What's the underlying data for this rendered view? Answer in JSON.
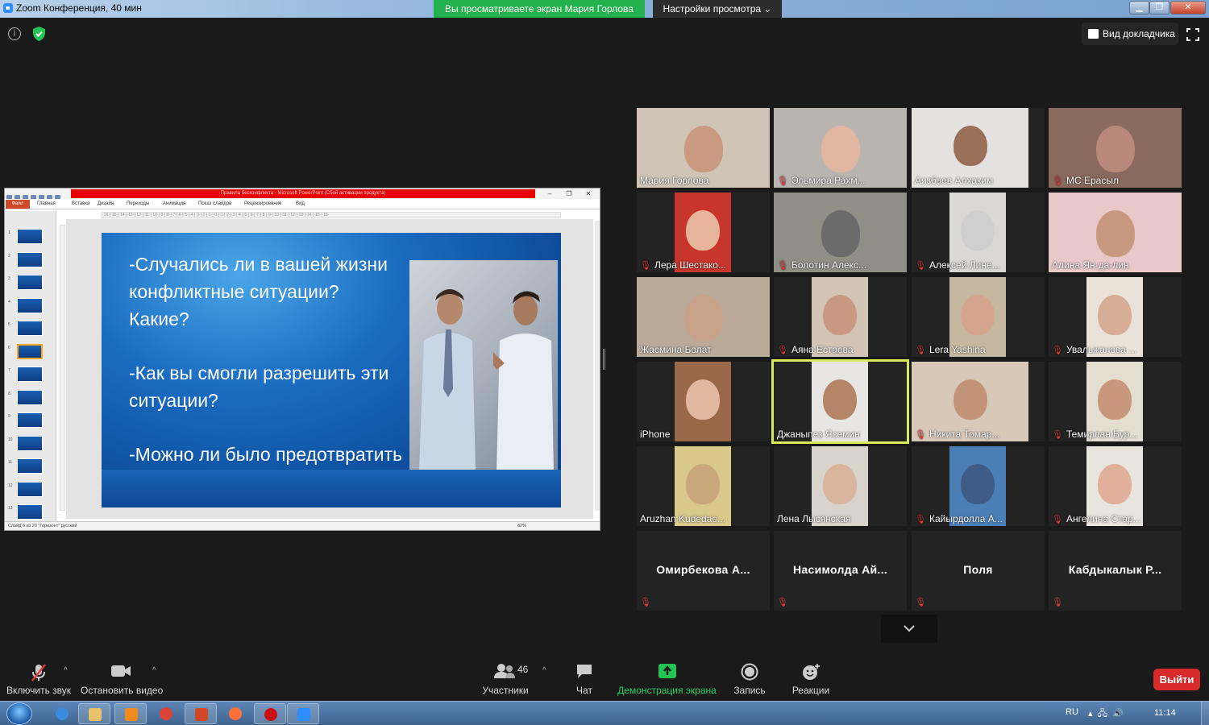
{
  "window": {
    "title": "Zoom Конференция, 40 мин",
    "share_banner": "Вы просматриваете экран Мария Горлова",
    "view_options": "Настройки просмотра ⌄",
    "min": "▁",
    "max": "❐",
    "close": "✕"
  },
  "top": {
    "speaker_view_label": "Вид докладчика"
  },
  "ppt": {
    "window_title": "Правила бесконфликта - Microsoft PowerPoint (Сбой активации продукта)",
    "window_controls": [
      "–",
      "❐",
      "✕"
    ],
    "tabs": [
      "Файл",
      "Главная",
      "Вставка",
      "Дизайн",
      "Переходы",
      "Анимация",
      "Показ слайдов",
      "Рецензирование",
      "Вид"
    ],
    "ruler_text": "·16·|·15·|·14·|·13·|·12·|·11·|·10·|·9·|·8·|·7·|·6·|·5·|·4·|·3·|·2·|·1·|·0·|·1·|·2·|·3·|·4·|·5·|·6·|·7·|·8·|·9·|·10·|·11·|·12·|·13·|·14·|·15·|·16·",
    "thumbnail_numbers": [
      "1",
      "2",
      "3",
      "4",
      "5",
      "6",
      "7",
      "8",
      "9",
      "10",
      "11",
      "12",
      "13"
    ],
    "selected_thumbnail": "6",
    "slide_paragraphs": [
      "-Случались ли в вашей жизни конфликтные ситуации? Какие?",
      "-Как вы смогли разрешить эти ситуации?",
      "-Можно ли было предотвратить такие ситуации?"
    ],
    "status_left": "Слайд 6 из 20   \"Горизонт\"   русский",
    "zoom": "82%"
  },
  "participants_grid": [
    {
      "name": "Мария Горлова",
      "muted": false,
      "video": true,
      "skin": "#c99a80",
      "bg": "#cfc4b6"
    },
    {
      "name": "Эльмира Рахм...",
      "muted": true,
      "video": true,
      "skin": "#e0b6a0",
      "bg": "#b8b4b0"
    },
    {
      "name": "Аязбаев Алхаким",
      "muted": false,
      "video": true,
      "skin": "#9a7058",
      "bg": "#e3e2e0"
    },
    {
      "name": "МС Ерасыл",
      "muted": true,
      "video": true,
      "skin": "#b8897a",
      "bg": "#8a6a5e"
    },
    {
      "name": "Лера Шестако...",
      "muted": true,
      "video": true,
      "skin": "#e6b49b",
      "bg": "#c7352b"
    },
    {
      "name": "Болотин Алекс...",
      "muted": true,
      "video": true,
      "skin": "#6b6b6b",
      "bg": "#8f8f86"
    },
    {
      "name": "Алексей Лине...",
      "muted": true,
      "video": true,
      "skin": "#cfcfcf",
      "bg": "#d9d8d5"
    },
    {
      "name": "Алина Ян-да-лин",
      "muted": false,
      "video": true,
      "skin": "#c79a80",
      "bg": "#e8c8c8"
    },
    {
      "name": "Жасмина Болат",
      "muted": false,
      "video": true,
      "skin": "#c8a38a",
      "bg": "#b9aa9a"
    },
    {
      "name": "Аяна Естаева",
      "muted": true,
      "video": true,
      "skin": "#c99880",
      "bg": "#d3c5b6"
    },
    {
      "name": "Lera Yashina",
      "muted": true,
      "video": true,
      "skin": "#d4a58a",
      "bg": "#c5b7a0"
    },
    {
      "name": "Увальжанова ...",
      "muted": true,
      "video": true,
      "skin": "#d7ad96",
      "bg": "#eae2d8"
    },
    {
      "name": "iPhone",
      "muted": false,
      "video": true,
      "skin": "#e1b7a0",
      "bg": "#9a6a48"
    },
    {
      "name": "Джаныпез Ясемин",
      "muted": false,
      "video": true,
      "skin": "#b48566",
      "bg": "#e8e6e2"
    },
    {
      "name": "Никита Томар...",
      "muted": true,
      "video": true,
      "skin": "#c39378",
      "bg": "#d7c8b8"
    },
    {
      "name": "Темирлан Бур...",
      "muted": true,
      "video": true,
      "skin": "#c9977c",
      "bg": "#e4ded0"
    },
    {
      "name": "Aruzhan Kudedae...",
      "muted": false,
      "video": true,
      "skin": "#c9a77a",
      "bg": "#d9c98a"
    },
    {
      "name": "Лена Лысянская",
      "muted": false,
      "video": true,
      "skin": "#d8b59c",
      "bg": "#d8d4cc"
    },
    {
      "name": "Кайырдолла А...",
      "muted": true,
      "video": true,
      "skin": "#3f5c86",
      "bg": "#4b7fb8"
    },
    {
      "name": "Ангелина Стар...",
      "muted": true,
      "video": true,
      "skin": "#e0b09a",
      "bg": "#e8e4de"
    },
    {
      "name": "Омирбекова А...",
      "muted": true,
      "video": false
    },
    {
      "name": "Насимолда Ай...",
      "muted": true,
      "video": false
    },
    {
      "name": "Поля",
      "muted": true,
      "video": false
    },
    {
      "name": "Кабдыкалык Р...",
      "muted": true,
      "video": false
    }
  ],
  "toolbar": {
    "unmute_label": "Включить звук",
    "stop_video_label": "Остановить видео",
    "participants_label": "Участники",
    "participants_count": "46",
    "chat_label": "Чат",
    "share_label": "Демонстрация экрана",
    "record_label": "Запись",
    "reactions_label": "Реакции",
    "leave_label": "Выйти"
  },
  "taskbar": {
    "apps": [
      {
        "icon": "internet-explorer-icon",
        "color": "#3a8be0"
      },
      {
        "icon": "file-explorer-icon",
        "color": "#e8c26a"
      },
      {
        "icon": "media-player-icon",
        "color": "#f08a1c"
      },
      {
        "icon": "chrome-icon",
        "color": "#db4437"
      },
      {
        "icon": "powerpoint-icon",
        "color": "#d24726"
      },
      {
        "icon": "firefox-icon",
        "color": "#ff7139"
      },
      {
        "icon": "opera-icon",
        "color": "#cc0f16"
      },
      {
        "icon": "zoom-icon",
        "color": "#2d8cff"
      }
    ],
    "lang": "RU",
    "clock": "11:14"
  }
}
